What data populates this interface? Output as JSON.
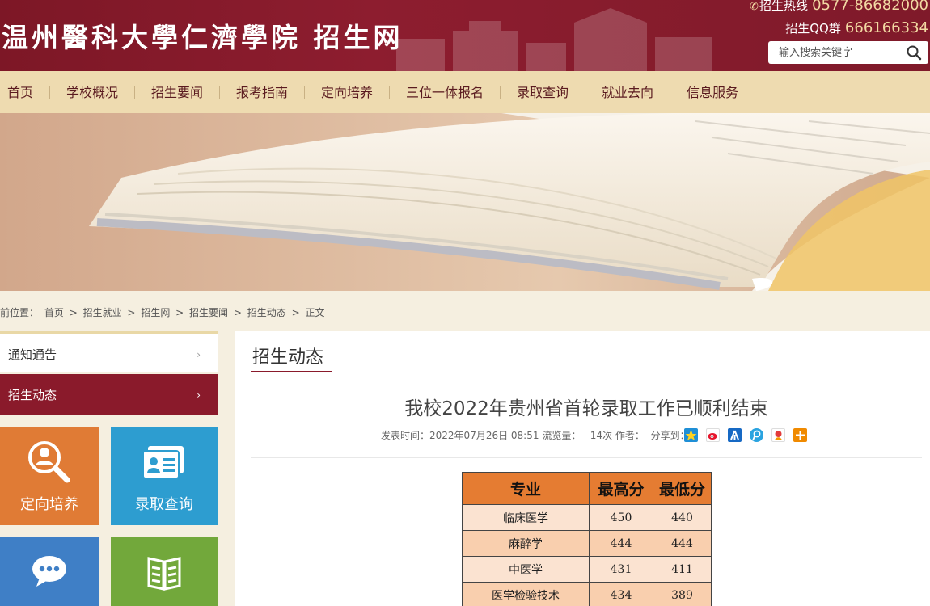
{
  "header": {
    "site_title": "温州醫科大學仁濟學院 招生网",
    "hotline_label": "招生热线",
    "hotline_number": "0577-86682000",
    "qq_label": "招生QQ群",
    "qq_number": "666166334",
    "search_placeholder": "输入搜索关键字"
  },
  "nav": {
    "items": [
      "首页",
      "学校概况",
      "招生要闻",
      "报考指南",
      "定向培养",
      "三位一体报名",
      "录取查询",
      "就业去向",
      "信息服务"
    ]
  },
  "breadcrumb": {
    "prefix": "前位置：",
    "items": [
      "首页",
      "招生就业",
      "招生网",
      "招生要闻",
      "招生动态",
      "正文"
    ],
    "separator": ">"
  },
  "sidebar": {
    "items": [
      {
        "label": "通知通告",
        "active": false
      },
      {
        "label": "招生动态",
        "active": true
      }
    ],
    "tiles": [
      {
        "label": "定向培养",
        "color": "#e07b35",
        "icon": "search-person-icon"
      },
      {
        "label": "录取查询",
        "color": "#2d9dd0",
        "icon": "id-card-icon"
      },
      {
        "label": "",
        "color": "#3f7fc6",
        "icon": "chat-bubble-icon"
      },
      {
        "label": "",
        "color": "#72a83b",
        "icon": "open-book-icon"
      }
    ]
  },
  "main": {
    "category_title": "招生动态",
    "article_title": "我校2022年贵州省首轮录取工作已顺利结束",
    "meta": {
      "publish_label": "发表时间：",
      "publish_time": "2022年07月26日 08:51",
      "views_label": "流览量：",
      "views": "14次",
      "author_label": "作者：",
      "share_label": "分享到："
    },
    "share_icons": [
      "qzone-icon",
      "weibo-icon",
      "renren-icon",
      "tencent-weibo-icon",
      "kaixin-icon",
      "more-share-icon"
    ],
    "table": {
      "headers": [
        "专业",
        "最高分",
        "最低分"
      ],
      "rows": [
        {
          "major": "临床医学",
          "max": "450",
          "min": "440"
        },
        {
          "major": "麻醉学",
          "max": "444",
          "min": "444"
        },
        {
          "major": "中医学",
          "max": "431",
          "min": "411"
        },
        {
          "major": "医学检验技术",
          "max": "434",
          "min": "389"
        }
      ]
    }
  },
  "colors": {
    "brand": "#8a1a2b",
    "nav_bg": "#eedbb0",
    "crumb_bg": "#f5efe0",
    "table_header": "#e57c32"
  }
}
